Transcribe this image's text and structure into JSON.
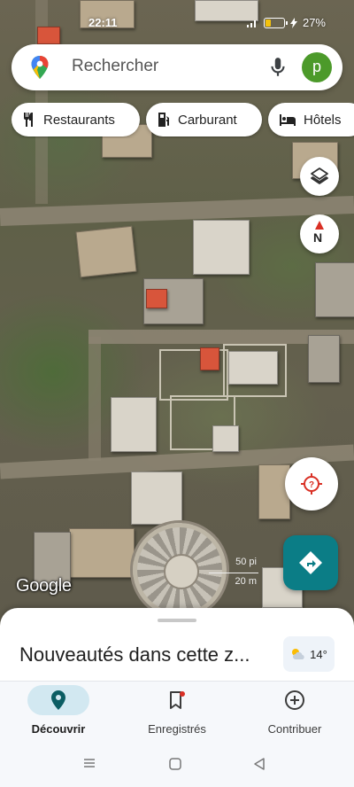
{
  "status_bar": {
    "time": "22:11",
    "battery_percent": "27%"
  },
  "search": {
    "placeholder": "Rechercher",
    "avatar_letter": "p"
  },
  "chips": [
    {
      "label": "Restaurants",
      "icon": "restaurant-icon"
    },
    {
      "label": "Carburant",
      "icon": "fuel-icon"
    },
    {
      "label": "Hôtels",
      "icon": "hotel-icon"
    }
  ],
  "map": {
    "compass_letter": "N",
    "logo_text": "Google",
    "scale_feet": "50 pi",
    "scale_meters": "20 m"
  },
  "sheet": {
    "title": "Nouveautés dans cette z...",
    "weather_temp": "14°"
  },
  "bottom_nav": {
    "items": [
      {
        "label": "Découvrir",
        "icon": "location-pin-icon",
        "active": true
      },
      {
        "label": "Enregistrés",
        "icon": "bookmark-icon",
        "active": false
      },
      {
        "label": "Contribuer",
        "icon": "add-circle-icon",
        "active": false
      }
    ]
  },
  "colors": {
    "accent_teal": "#0b7d86",
    "active_pill": "#d2e8f1",
    "avatar_green": "#4c9a2a"
  }
}
